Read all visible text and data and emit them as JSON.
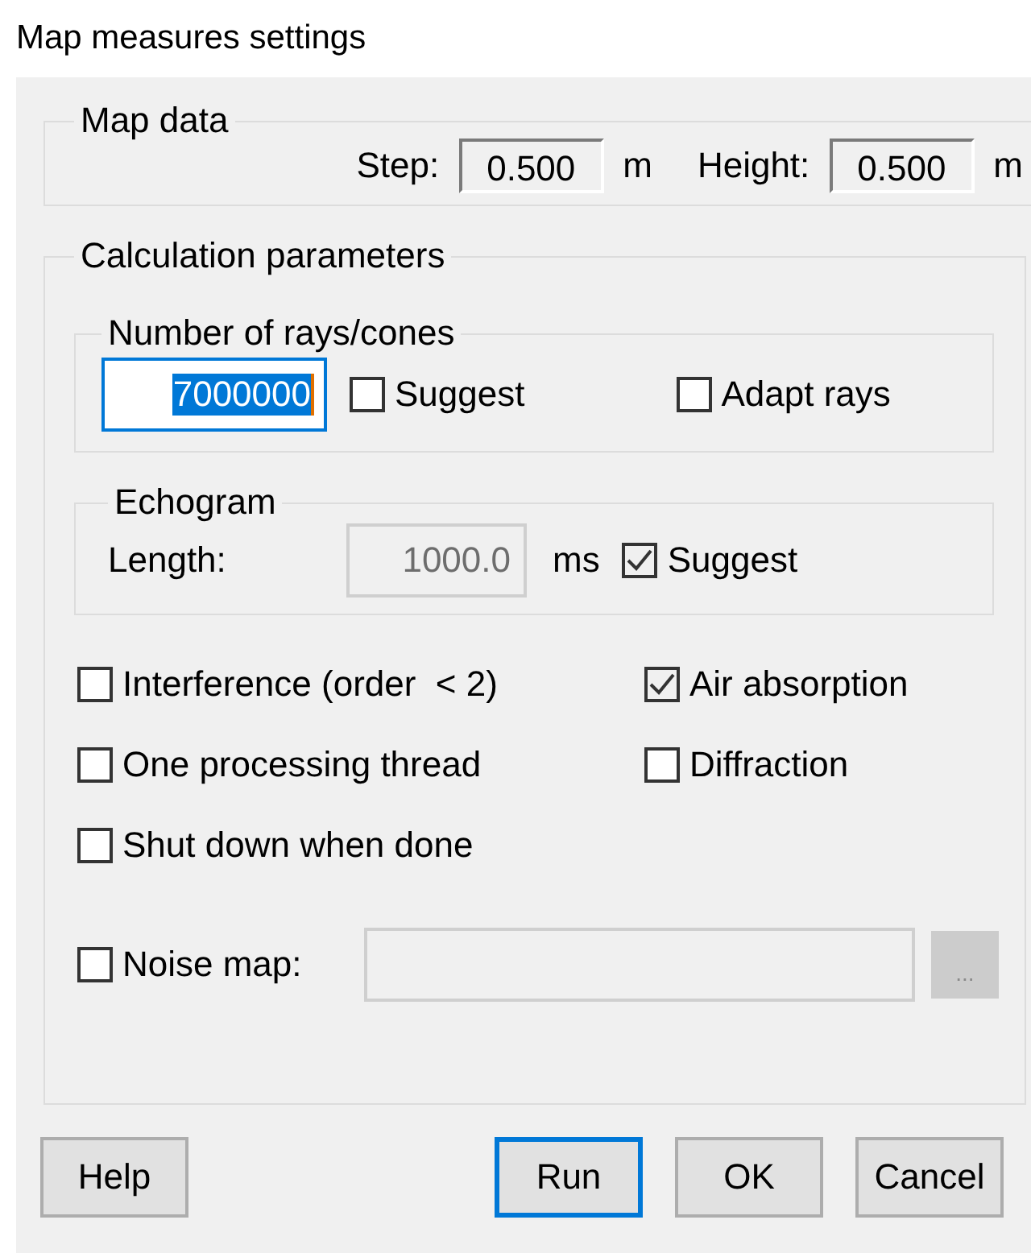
{
  "window": {
    "title": "Map measures settings"
  },
  "map_data": {
    "title": "Map data",
    "fields": [
      {
        "label": "Step:",
        "value": "0.500",
        "unit": "m"
      },
      {
        "label": "Height:",
        "value": "0.500",
        "unit": "m"
      }
    ]
  },
  "calculation": {
    "title": "Calculation parameters",
    "rays": {
      "title": "Number of rays/cones",
      "value": "7000000",
      "focused": true,
      "options": [
        {
          "label": "Suggest",
          "checked": false
        },
        {
          "label": "Adapt rays",
          "checked": false
        }
      ]
    },
    "echogram": {
      "title": "Echogram",
      "label": "Length:",
      "value": "1000.0",
      "disabled": true,
      "unit": "ms",
      "suggest": {
        "label": "Suggest",
        "checked": true
      }
    },
    "options": [
      {
        "label": "Interference (order  < 2)",
        "checked": false
      },
      {
        "label": "Air absorption",
        "checked": true
      },
      {
        "label": "One processing thread",
        "checked": false
      },
      {
        "label": "Diffraction",
        "checked": false
      },
      {
        "label": "Shut down when done",
        "checked": false
      }
    ],
    "noise_map": {
      "label": "Noise map:",
      "checked": false,
      "disabled": true,
      "browse": "..."
    }
  },
  "buttons": [
    {
      "label": "Help",
      "default": false
    },
    {
      "label": "Run",
      "default": true
    },
    {
      "label": "OK",
      "default": false
    },
    {
      "label": "Cancel",
      "default": false
    }
  ]
}
